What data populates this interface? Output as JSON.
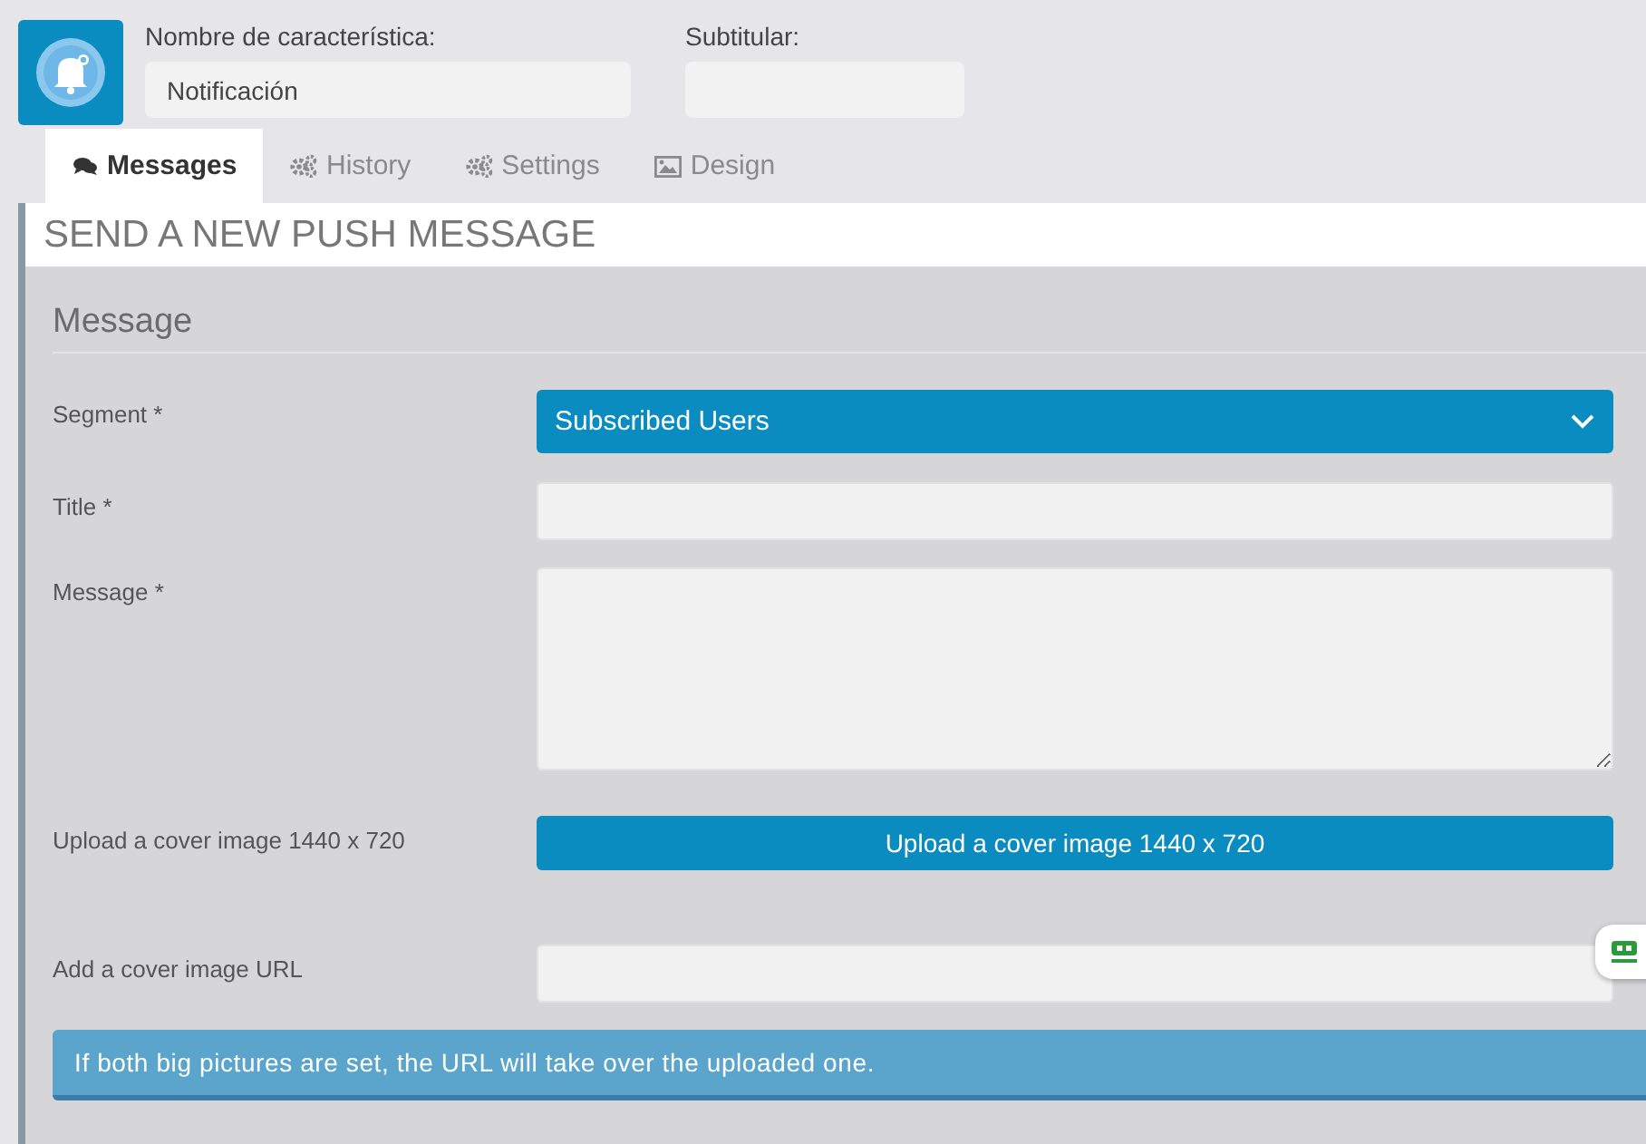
{
  "header": {
    "fields": [
      {
        "label": "Nombre de característica:",
        "value": "Notificación"
      },
      {
        "label": "Subtitular:"
      }
    ]
  },
  "tabs": [
    {
      "label": "Messages",
      "selected": true
    },
    {
      "label": "History",
      "selected": false
    },
    {
      "label": "Settings",
      "selected": false
    },
    {
      "label": "Design",
      "selected": false
    }
  ],
  "panel": {
    "title": "SEND A NEW PUSH MESSAGE",
    "section": "Message",
    "rows": [
      {
        "kind": "select",
        "label": "Segment *",
        "value": "Subscribed Users"
      },
      {
        "kind": "input",
        "label": "Title *"
      },
      {
        "kind": "textarea",
        "label": "Message *"
      },
      {
        "kind": "button",
        "label": "Upload a cover image 1440 x 720",
        "button": "Upload a cover image 1440 x 720"
      },
      {
        "kind": "input",
        "label": "Add a cover image URL"
      }
    ],
    "notice": "If both big pictures are set, the URL will take over the uploaded one."
  }
}
